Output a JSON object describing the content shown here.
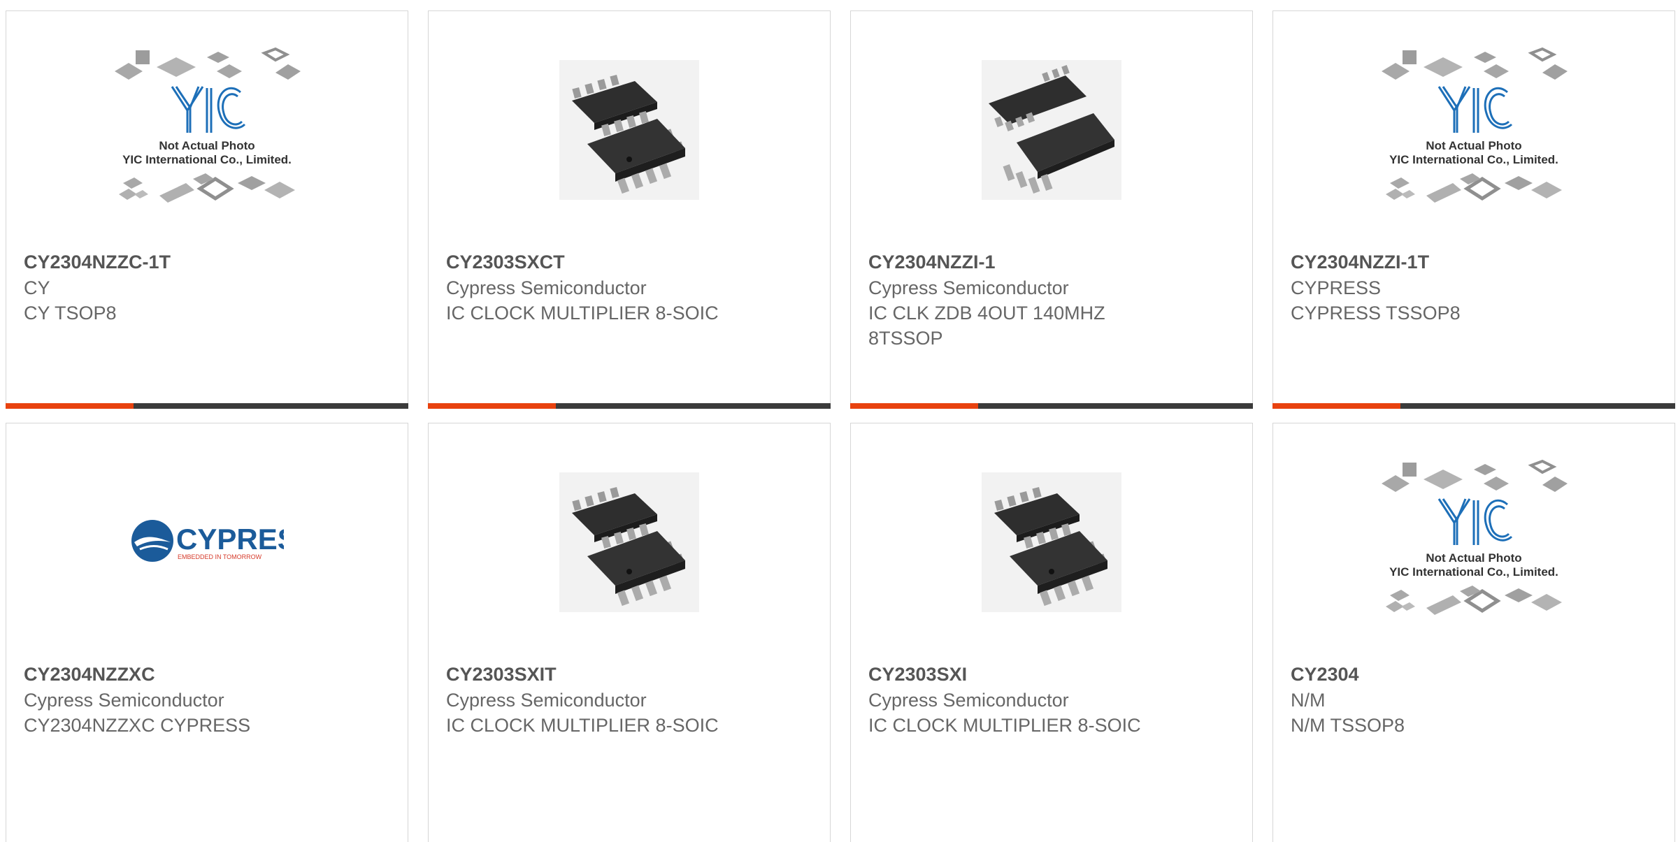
{
  "colors": {
    "accent": "#e8420f",
    "bar": "#3b3b3b",
    "border": "#d6d6d6",
    "text": "#555555"
  },
  "products": [
    {
      "part": "CY2304NZZC-1T",
      "maker": "CY",
      "desc": "CY TSOP8",
      "image": "placeholder",
      "caption1": "Not Actual Photo",
      "caption2": "YIC International Co., Limited.",
      "logo": "YIC"
    },
    {
      "part": "CY2303SXCT",
      "maker": "Cypress Semiconductor",
      "desc": "IC CLOCK MULTIPLIER 8-SOIC",
      "image": "chip-soic"
    },
    {
      "part": "CY2304NZZI-1",
      "maker": "Cypress Semiconductor",
      "desc": "IC CLK ZDB 4OUT 140MHZ 8TSSOP",
      "image": "chip-tssop"
    },
    {
      "part": "CY2304NZZI-1T",
      "maker": "CYPRESS",
      "desc": "CYPRESS TSSOP8",
      "image": "placeholder",
      "caption1": "Not Actual Photo",
      "caption2": "YIC International Co., Limited.",
      "logo": "YIC"
    },
    {
      "part": "CY2304NZZXC",
      "maker": "Cypress Semiconductor",
      "desc": "CY2304NZZXC CYPRESS",
      "image": "cypress-logo",
      "logo_word": "CYPRESS",
      "logo_tag": "EMBEDDED IN TOMORROW"
    },
    {
      "part": "CY2303SXIT",
      "maker": "Cypress Semiconductor",
      "desc": "IC CLOCK MULTIPLIER 8-SOIC",
      "image": "chip-soic"
    },
    {
      "part": "CY2303SXI",
      "maker": "Cypress Semiconductor",
      "desc": "IC CLOCK MULTIPLIER 8-SOIC",
      "image": "chip-soic"
    },
    {
      "part": "CY2304",
      "maker": "N/M",
      "desc": "N/M TSSOP8",
      "image": "placeholder",
      "caption1": "Not Actual Photo",
      "caption2": "YIC International Co., Limited.",
      "logo": "YIC"
    }
  ]
}
